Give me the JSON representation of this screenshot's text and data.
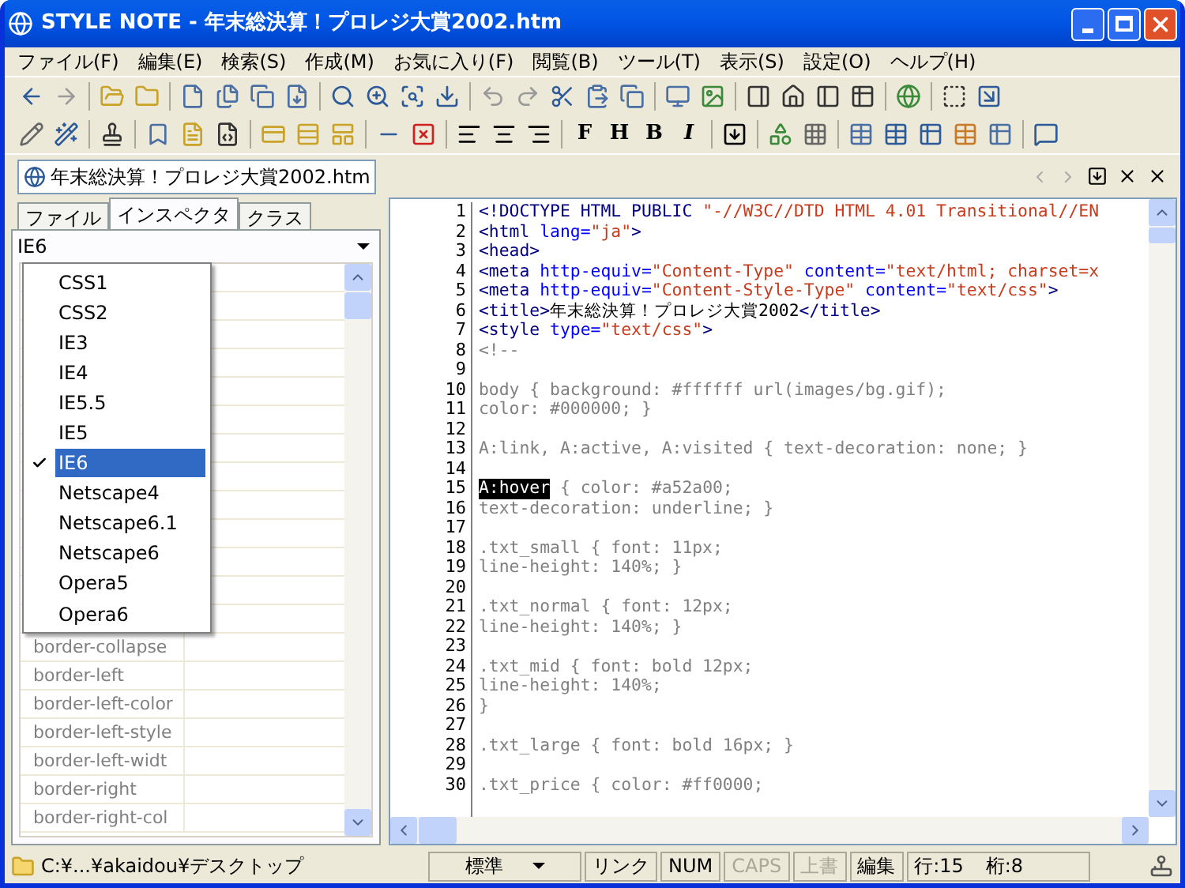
{
  "window": {
    "title": "STYLE NOTE - 年末総決算！プロレジ大賞2002.htm"
  },
  "menu": [
    "ファイル(F)",
    "編集(E)",
    "検索(S)",
    "作成(M)",
    "お気に入り(F)",
    "閲覧(B)",
    "ツール(T)",
    "表示(S)",
    "設定(O)",
    "ヘルプ(H)"
  ],
  "format_buttons": [
    "F",
    "H",
    "B",
    "I"
  ],
  "document_tab": {
    "label": "年末総決算！プロレジ大賞2002.htm"
  },
  "panel_tabs": [
    {
      "label": "ファイル",
      "selected": false
    },
    {
      "label": "インスペクタ",
      "selected": true
    },
    {
      "label": "クラス",
      "selected": false
    }
  ],
  "browser_select": {
    "value": "IE6"
  },
  "browser_menu": [
    {
      "label": "CSS1",
      "selected": false
    },
    {
      "label": "CSS2",
      "selected": false
    },
    {
      "label": "IE3",
      "selected": false
    },
    {
      "label": "IE4",
      "selected": false
    },
    {
      "label": "IE5.5",
      "selected": false
    },
    {
      "label": "IE5",
      "selected": false
    },
    {
      "label": "IE6",
      "selected": true
    },
    {
      "label": "Netscape4",
      "selected": false
    },
    {
      "label": "Netscape6.1",
      "selected": false
    },
    {
      "label": "Netscape6",
      "selected": false
    },
    {
      "label": "Opera5",
      "selected": false
    },
    {
      "label": "Opera6",
      "selected": false
    }
  ],
  "properties": [
    "border-collapse",
    "border-left",
    "border-left-color",
    "border-left-style",
    "border-left-widt",
    "border-right",
    "border-right-col"
  ],
  "code_lines": [
    {
      "number": "1",
      "segments": [
        {
          "kind": "tag",
          "text": "<!DOCTYPE HTML PUBLIC "
        },
        {
          "kind": "string",
          "text": "\"-//W3C//DTD HTML 4.01 Transitional//EN"
        }
      ]
    },
    {
      "number": "2",
      "segments": [
        {
          "kind": "tag",
          "text": "<html "
        },
        {
          "kind": "attr",
          "text": "lang="
        },
        {
          "kind": "string",
          "text": "\"ja\""
        },
        {
          "kind": "tag",
          "text": ">"
        }
      ]
    },
    {
      "number": "3",
      "segments": [
        {
          "kind": "tag",
          "text": "<head>"
        }
      ]
    },
    {
      "number": "4",
      "segments": [
        {
          "kind": "tag",
          "text": "<meta "
        },
        {
          "kind": "attr",
          "text": "http-equiv="
        },
        {
          "kind": "string",
          "text": "\"Content-Type\""
        },
        {
          "kind": "attr",
          "text": " content="
        },
        {
          "kind": "string",
          "text": "\"text/html; charset=x"
        }
      ]
    },
    {
      "number": "5",
      "segments": [
        {
          "kind": "tag",
          "text": "<meta "
        },
        {
          "kind": "attr",
          "text": "http-equiv="
        },
        {
          "kind": "string",
          "text": "\"Content-Style-Type\""
        },
        {
          "kind": "attr",
          "text": " content="
        },
        {
          "kind": "string",
          "text": "\"text/css\""
        },
        {
          "kind": "tag",
          "text": ">"
        }
      ]
    },
    {
      "number": "6",
      "segments": [
        {
          "kind": "tag",
          "text": "<title>"
        },
        {
          "kind": "text",
          "text": "年末総決算！プロレジ大賞2002"
        },
        {
          "kind": "tag",
          "text": "</title>"
        }
      ]
    },
    {
      "number": "7",
      "segments": [
        {
          "kind": "tag",
          "text": "<style "
        },
        {
          "kind": "attr",
          "text": "type="
        },
        {
          "kind": "string",
          "text": "\"text/css\""
        },
        {
          "kind": "tag",
          "text": ">"
        }
      ]
    },
    {
      "number": "8",
      "segments": [
        {
          "kind": "css",
          "text": "<!--"
        }
      ]
    },
    {
      "number": "9"
    },
    {
      "number": "10",
      "segments": [
        {
          "kind": "css",
          "text": "body { background: #ffffff url(images/bg.gif);"
        }
      ]
    },
    {
      "number": "11",
      "segments": [
        {
          "kind": "css",
          "text": "color: #000000; }"
        }
      ]
    },
    {
      "number": "12"
    },
    {
      "number": "13",
      "segments": [
        {
          "kind": "css",
          "text": "A:link, A:active, A:visited { text-decoration: none; }"
        }
      ]
    },
    {
      "number": "14"
    },
    {
      "number": "15",
      "segments": [
        {
          "kind": "selection",
          "text": "A:hover"
        },
        {
          "kind": "css",
          "text": " { color: #a52a00;"
        }
      ]
    },
    {
      "number": "16",
      "segments": [
        {
          "kind": "css",
          "text": "text-decoration: underline; }"
        }
      ]
    },
    {
      "number": "17"
    },
    {
      "number": "18",
      "segments": [
        {
          "kind": "css",
          "text": ".txt_small { font: 11px;"
        }
      ]
    },
    {
      "number": "19",
      "segments": [
        {
          "kind": "css",
          "text": "line-height: 140%; }"
        }
      ]
    },
    {
      "number": "20"
    },
    {
      "number": "21",
      "segments": [
        {
          "kind": "css",
          "text": ".txt_normal { font: 12px;"
        }
      ]
    },
    {
      "number": "22",
      "segments": [
        {
          "kind": "css",
          "text": "line-height: 140%; }"
        }
      ]
    },
    {
      "number": "23"
    },
    {
      "number": "24",
      "segments": [
        {
          "kind": "css",
          "text": ".txt_mid { font: bold 12px;"
        }
      ]
    },
    {
      "number": "25",
      "segments": [
        {
          "kind": "css",
          "text": "line-height: 140%;"
        }
      ]
    },
    {
      "number": "26",
      "segments": [
        {
          "kind": "css",
          "text": "}"
        }
      ]
    },
    {
      "number": "27"
    },
    {
      "number": "28",
      "segments": [
        {
          "kind": "css",
          "text": ".txt_large { font: bold 16px; }"
        }
      ]
    },
    {
      "number": "29"
    },
    {
      "number": "30",
      "segments": [
        {
          "kind": "css",
          "text": ".txt_price { color: #ff0000;"
        }
      ]
    }
  ],
  "status_bar": {
    "path": "C:¥...¥akaidou¥デスクトップ",
    "panes": [
      {
        "text": "標準",
        "kind": "dropdown",
        "disabled": false
      },
      {
        "text": "リンク",
        "kind": "plain",
        "disabled": false
      },
      {
        "text": "NUM",
        "kind": "plain",
        "disabled": false
      },
      {
        "text": "CAPS",
        "kind": "plain",
        "disabled": true
      },
      {
        "text": "上書",
        "kind": "plain",
        "disabled": true
      },
      {
        "text": "編集",
        "kind": "plain",
        "disabled": false
      }
    ],
    "row": "行:15",
    "column": "桁:8"
  }
}
